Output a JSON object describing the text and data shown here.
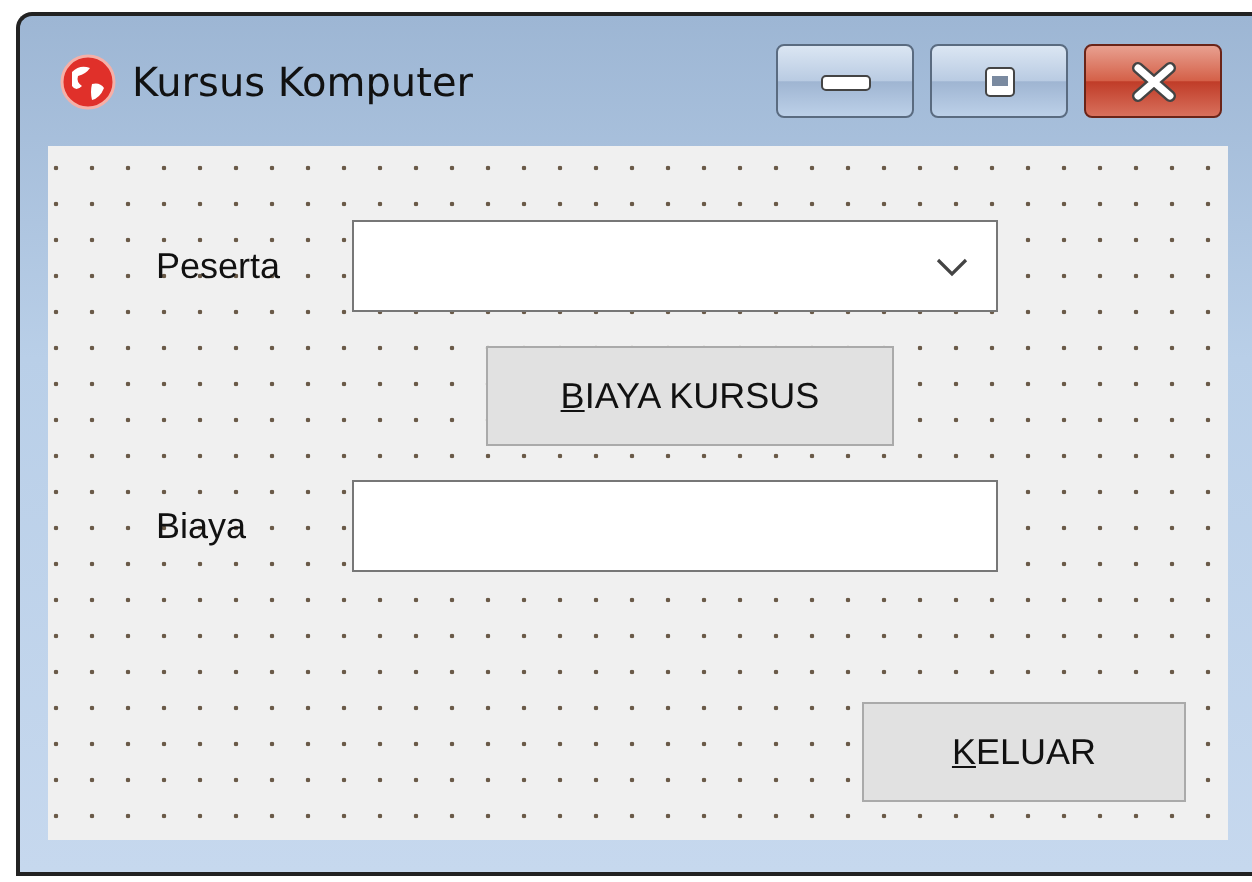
{
  "window": {
    "title": "Kursus Komputer"
  },
  "controls": [
    {
      "kind": "combo",
      "label": "Peserta"
    },
    {
      "kind": "button",
      "access_key": "B",
      "label_rest": "IAYA KURSUS"
    },
    {
      "kind": "text",
      "label": "Biaya"
    },
    {
      "kind": "button",
      "access_key": "K",
      "label_rest": "ELUAR"
    }
  ]
}
